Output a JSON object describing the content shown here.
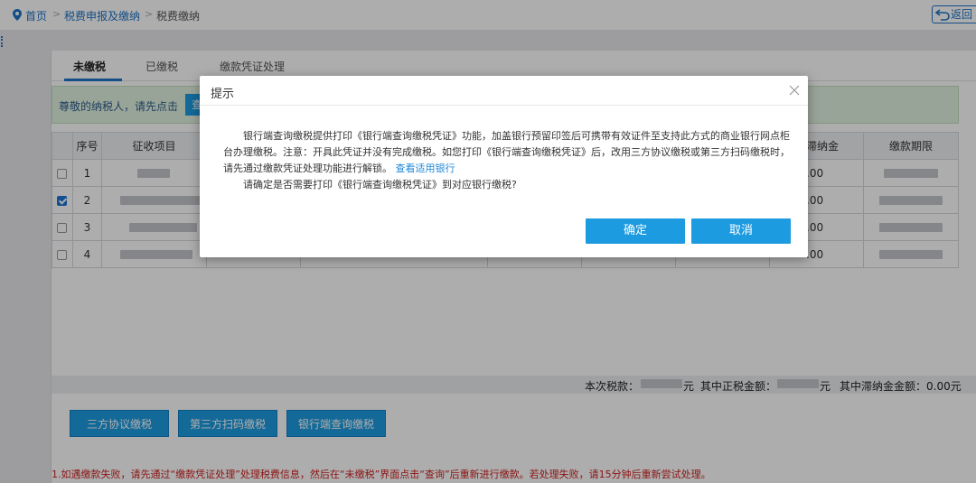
{
  "breadcrumb": {
    "home": "首页",
    "parent": "税费申报及缴纳",
    "current": "税费缴纳",
    "separator": ">"
  },
  "back_label": "返回",
  "tabs": [
    "未缴税",
    "已缴税",
    "缴款凭证处理"
  ],
  "notice": {
    "text": "尊敬的纳税人，请先点击",
    "button": "查"
  },
  "table": {
    "headers": [
      "序号",
      "征收项目",
      "滞纳金",
      "缴款期限"
    ],
    "rows": [
      {
        "no": "1",
        "checked": false,
        "late_fee": ".00"
      },
      {
        "no": "2",
        "checked": true,
        "late_fee": ".00"
      },
      {
        "no": "3",
        "checked": false,
        "late_fee": ".00"
      },
      {
        "no": "4",
        "checked": false,
        "late_fee": ".00"
      }
    ]
  },
  "summary": {
    "tax_label": "本次税款：",
    "tax_unit": "元",
    "principal_label": "其中正税金额：",
    "principal_unit": "元",
    "late_fee_text": "其中滞纳金金额：0.00元"
  },
  "buttons": {
    "tripartite": "三方协议缴税",
    "qr": "第三方扫码缴税",
    "bank": "银行端查询缴税"
  },
  "warning": "1.如遇缴款失败，请先通过“缴款凭证处理”处理税费信息，然后在“未缴税”界面点击“查询”后重新进行缴款。若处理失败，请15分钟后重新尝试处理。",
  "modal": {
    "title": "提示",
    "para1": "银行端查询缴税提供打印《银行端查询缴税凭证》功能，加盖银行预留印签后可携带有效证件至支持此方式的商业银行网点柜台办理缴税。注意：开具此凭证并没有完成缴税。如您打印《银行端查询缴税凭证》后，改用三方协议缴税或第三方扫码缴税时，请先通过缴款凭证处理功能进行解锁。",
    "link": "查看适用银行",
    "para2": "请确定是否需要打印《银行端查询缴税凭证》到对应银行缴税?",
    "confirm": "确定",
    "cancel": "取消"
  }
}
